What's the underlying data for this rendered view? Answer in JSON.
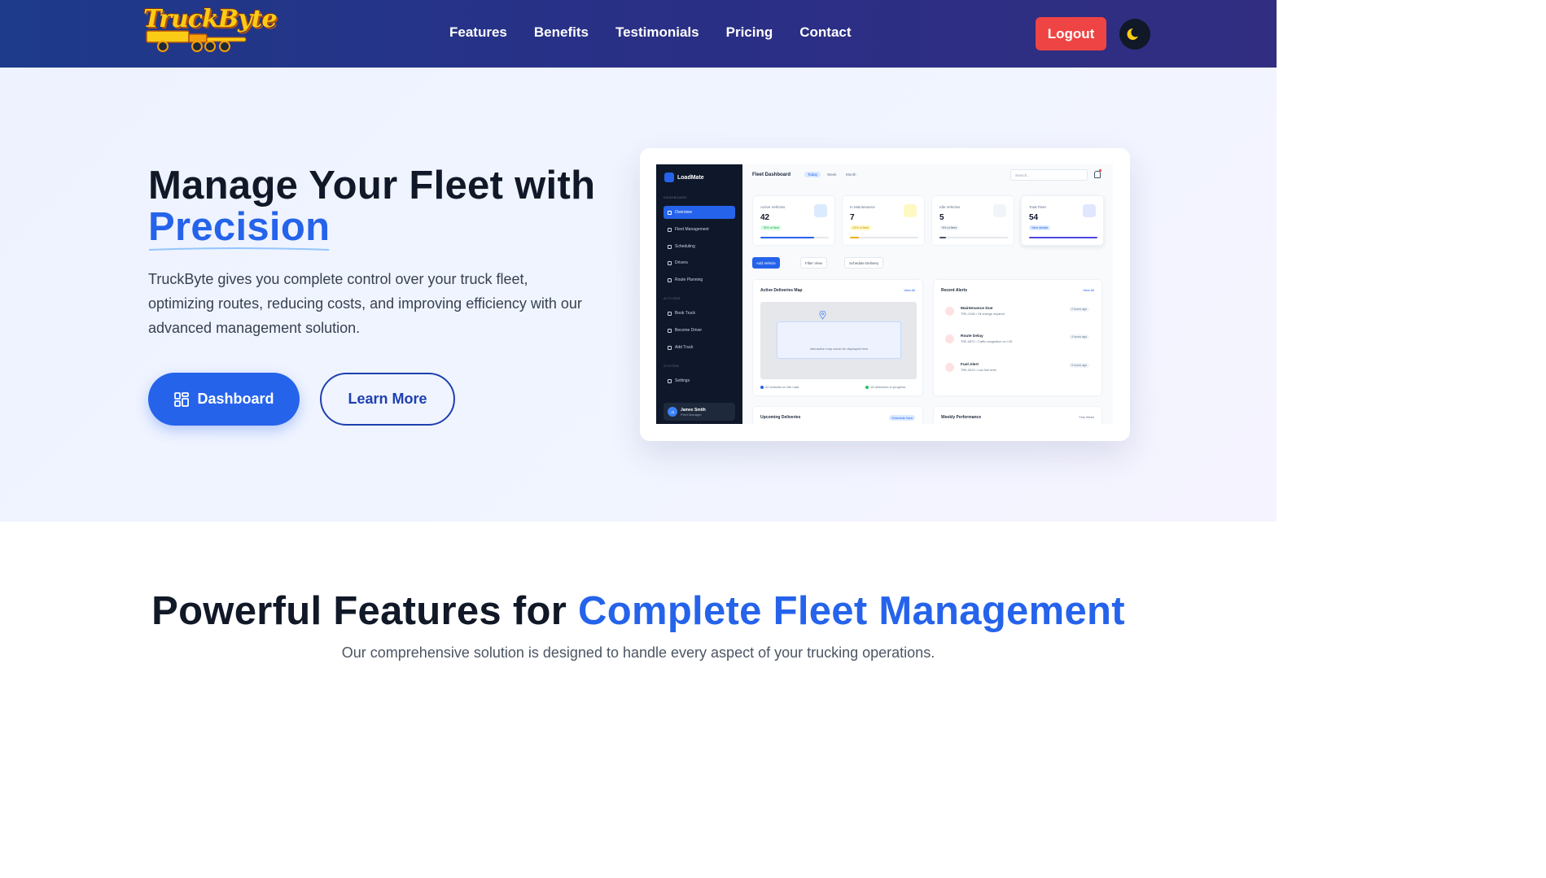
{
  "nav": {
    "logo_text": "TruckByte",
    "links": [
      "Features",
      "Benefits",
      "Testimonials",
      "Pricing",
      "Contact"
    ],
    "logout_label": "Logout",
    "theme_icon": "moon-icon"
  },
  "hero": {
    "title_line1": "Manage Your Fleet with",
    "title_accent": "Precision",
    "description": "TruckByte gives you complete control over your truck fleet, optimizing routes, reducing costs, and improving efficiency with our advanced management solution.",
    "dashboard_label": "Dashboard",
    "learn_more_label": "Learn More"
  },
  "mockup": {
    "brand": "LoadMate",
    "sections": {
      "dashboard": "DASHBOARD",
      "actions": "ACTIONS",
      "system": "SYSTEM"
    },
    "nav": {
      "overview": "Overview",
      "fleet": "Fleet Management",
      "scheduling": "Scheduling",
      "drivers": "Drivers",
      "route": "Route Planning",
      "book": "Book Truck",
      "become": "Become Driver",
      "add": "Add Truck",
      "settings": "Settings"
    },
    "user": {
      "initials": "JS",
      "name": "James Smith",
      "role": "Fleet Manager"
    },
    "title": "Fleet Dashboard",
    "tabs": [
      "Today",
      "Week",
      "Month"
    ],
    "search_placeholder": "Search...",
    "stats": [
      {
        "label": "Active Vehicles",
        "value": "42",
        "badge": "78% of fleet",
        "progress": 0.78
      },
      {
        "label": "In Maintenance",
        "value": "7",
        "badge": "13% of fleet",
        "progress": 0.13
      },
      {
        "label": "Idle Vehicles",
        "value": "5",
        "badge": "9% of fleet",
        "progress": 0.09
      },
      {
        "label": "Total Fleet",
        "value": "54",
        "badge": "View details",
        "progress": 1.0
      }
    ],
    "actions": {
      "add": "Add Vehicle",
      "filter": "Filter View",
      "schedule": "Schedule Delivery"
    },
    "map": {
      "title": "Active Deliveries Map",
      "view_all": "View All",
      "placeholder": "Interactive map would be displayed here",
      "legend_road": "42 vehicles on the road",
      "legend_progress": "16 deliveries in progress"
    },
    "alerts": {
      "title": "Recent Alerts",
      "view_all": "View All",
      "items": [
        {
          "title": "Maintenance Due",
          "sub": "TRK-1048 • Oil change required",
          "time": "2 hours ago"
        },
        {
          "title": "Route Delay",
          "sub": "TRK-0872 • Traffic congestion on I-95",
          "time": "4 hours ago"
        },
        {
          "title": "Fuel Alert",
          "sub": "TRK-0513 • Low fuel level",
          "time": "5 hours ago"
        }
      ]
    },
    "upcoming": {
      "title": "Upcoming Deliveries",
      "action": "Schedule Now"
    },
    "weekly": {
      "title": "Weekly Performance",
      "range": "This Week"
    }
  },
  "features": {
    "title_plain": "Powerful Features for ",
    "title_accent": "Complete Fleet Management",
    "subtitle": "Our comprehensive solution is designed to handle every aspect of your trucking operations."
  },
  "colors": {
    "nav_bg": "#1e3a8a",
    "accent": "#2563eb",
    "logout": "#ef4444",
    "logo": "#facc15"
  }
}
